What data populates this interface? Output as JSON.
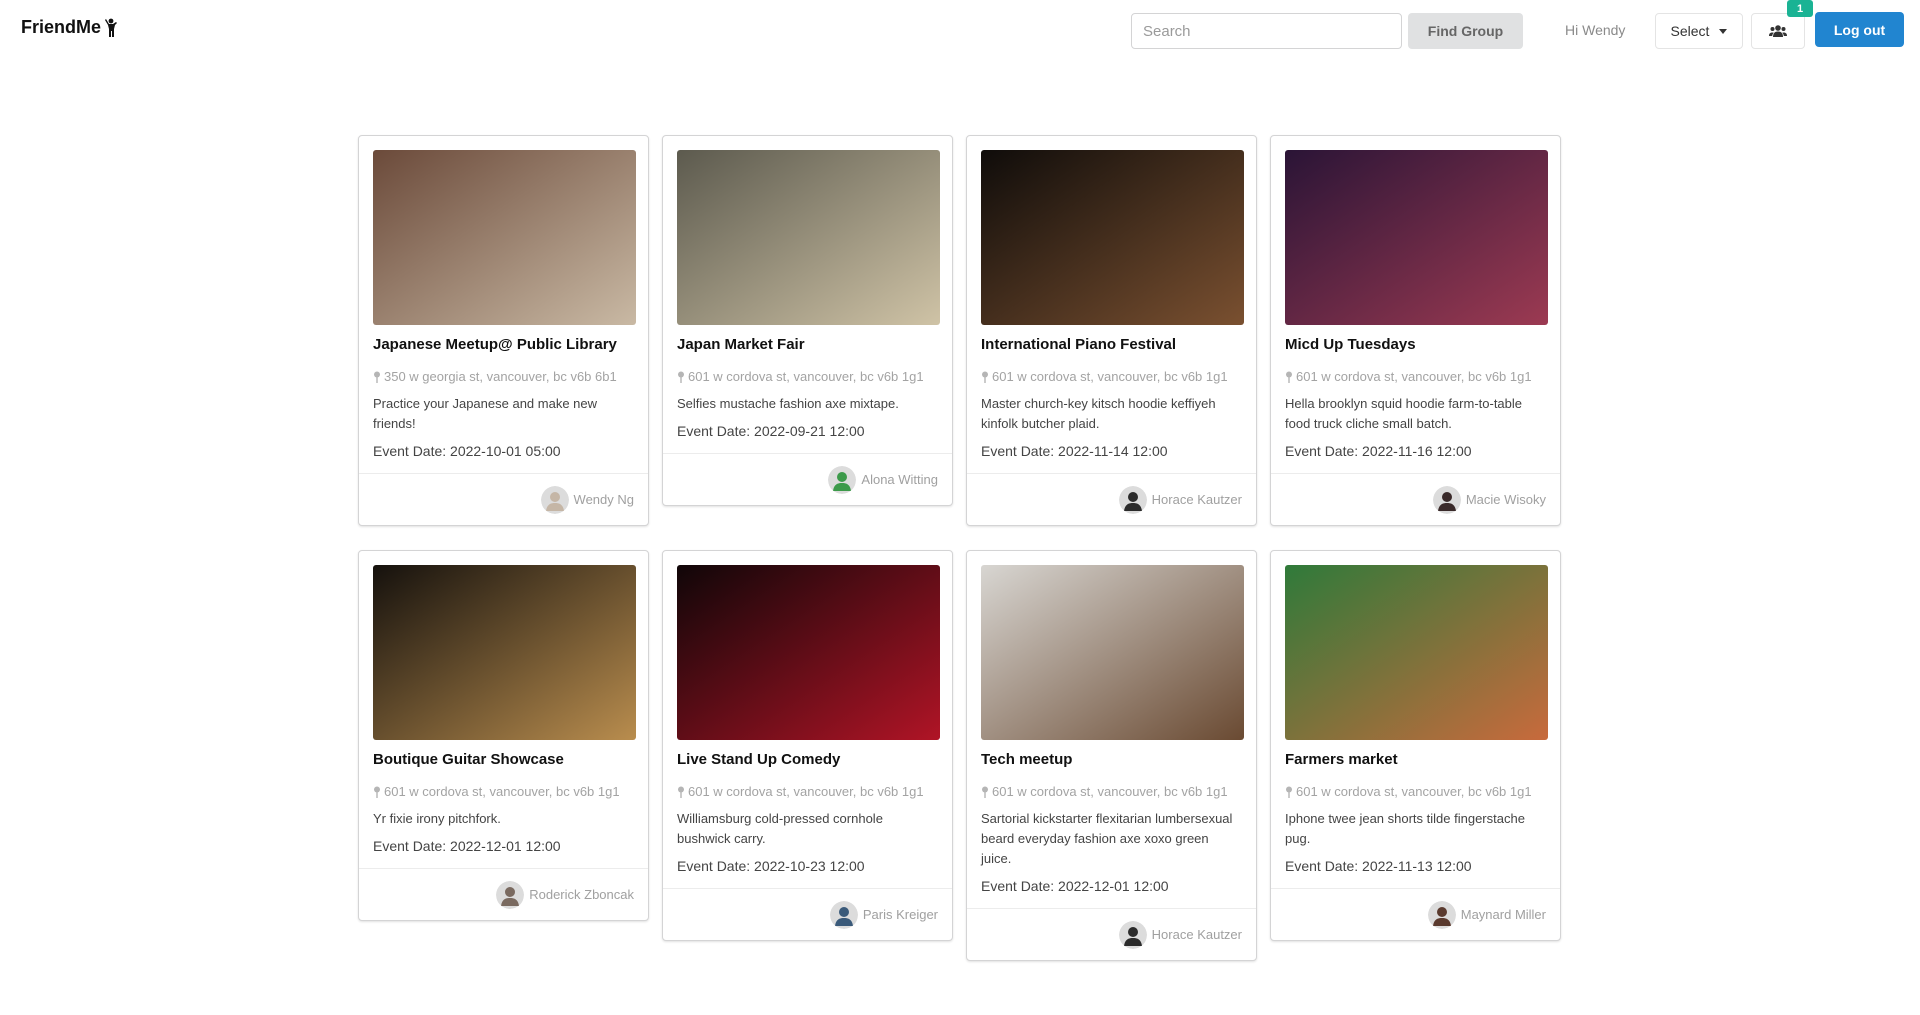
{
  "header": {
    "brand": "FriendMe",
    "search_placeholder": "Search",
    "find_group_label": "Find Group",
    "greeting": "Hi Wendy",
    "select_label": "Select",
    "group_badge_count": "1",
    "logout_label": "Log out"
  },
  "cards": [
    {
      "title": "Japanese Meetup@ Public Library",
      "location": "350 w georgia st, vancouver, bc v6b 6b1",
      "description": "Practice your Japanese and make new friends!",
      "date": "Event Date: 2022-10-01 05:00",
      "host": "Wendy Ng",
      "image_colors": [
        "#6b4a3a",
        "#c9b9a4"
      ],
      "avatar_color": "#c5b6a6"
    },
    {
      "title": "Japan Market Fair",
      "location": "601 w cordova st, vancouver, bc v6b 1g1",
      "description": "Selfies mustache fashion axe mixtape.",
      "date": "Event Date: 2022-09-21 12:00",
      "host": "Alona Witting",
      "image_colors": [
        "#5c5a4e",
        "#cfc3a6"
      ],
      "avatar_color": "#3c9a4a"
    },
    {
      "title": "International Piano Festival",
      "location": "601 w cordova st, vancouver, bc v6b 1g1",
      "description": "Master church-key kitsch hoodie keffiyeh kinfolk butcher plaid.",
      "date": "Event Date: 2022-11-14 12:00",
      "host": "Horace Kautzer",
      "image_colors": [
        "#0f0c0a",
        "#7a5030"
      ],
      "avatar_color": "#2b2b2b"
    },
    {
      "title": "Micd Up Tuesdays",
      "location": "601 w cordova st, vancouver, bc v6b 1g1",
      "description": "Hella brooklyn squid hoodie farm-to-table food truck cliche small batch.",
      "date": "Event Date: 2022-11-16 12:00",
      "host": "Macie Wisoky",
      "image_colors": [
        "#2a1436",
        "#9c3a52"
      ],
      "avatar_color": "#3a2a2a"
    },
    {
      "title": "Boutique Guitar Showcase",
      "location": "601 w cordova st, vancouver, bc v6b 1g1",
      "description": "Yr fixie irony pitchfork.",
      "date": "Event Date: 2022-12-01 12:00",
      "host": "Roderick Zboncak",
      "image_colors": [
        "#15110d",
        "#b98d4e"
      ],
      "avatar_color": "#7a6a60"
    },
    {
      "title": "Live Stand Up Comedy",
      "location": "601 w cordova st, vancouver, bc v6b 1g1",
      "description": "Williamsburg cold-pressed cornhole bushwick carry.",
      "date": "Event Date: 2022-10-23 12:00",
      "host": "Paris Kreiger",
      "image_colors": [
        "#100608",
        "#b01426"
      ],
      "avatar_color": "#3a5a7a"
    },
    {
      "title": "Tech meetup",
      "location": "601 w cordova st, vancouver, bc v6b 1g1",
      "description": "Sartorial kickstarter flexitarian lumbersexual beard everyday fashion axe xoxo green juice.",
      "date": "Event Date: 2022-12-01 12:00",
      "host": "Horace Kautzer",
      "image_colors": [
        "#d8d6d2",
        "#6a4a32"
      ],
      "avatar_color": "#2b2b2b"
    },
    {
      "title": "Farmers market",
      "location": "601 w cordova st, vancouver, bc v6b 1g1",
      "description": "Iphone twee jean shorts tilde fingerstache pug.",
      "date": "Event Date: 2022-11-13 12:00",
      "host": "Maynard Miller",
      "image_colors": [
        "#2f7a3a",
        "#c86a3c"
      ],
      "avatar_color": "#5a3a2e"
    }
  ]
}
